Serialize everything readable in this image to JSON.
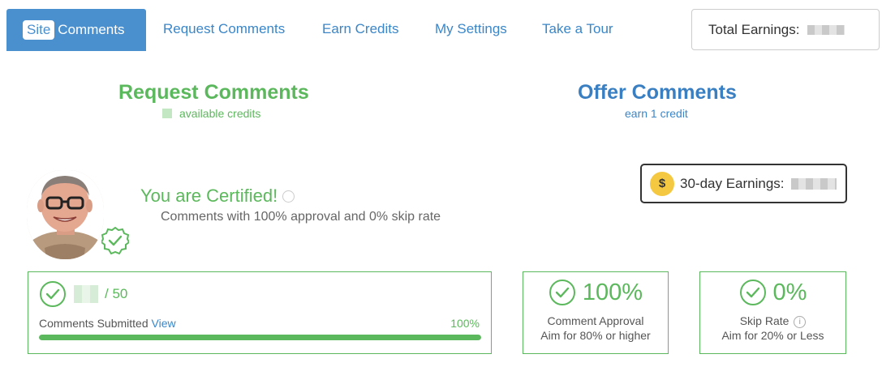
{
  "nav": {
    "active_tab": {
      "pill": "Site",
      "label": "Comments"
    },
    "links": [
      "Request Comments",
      "Earn Credits",
      "My Settings",
      "Take a Tour"
    ],
    "total_earnings_label": "Total Earnings:"
  },
  "request": {
    "title": "Request Comments",
    "subtitle": "available credits"
  },
  "offer": {
    "title": "Offer Comments",
    "subtitle": "earn 1 credit"
  },
  "certified": {
    "title": "You are Certified!",
    "description": "Comments with 100% approval and 0% skip rate"
  },
  "earnings_30day": {
    "icon": "$",
    "label": "30-day Earnings:"
  },
  "stats": {
    "submitted": {
      "total": "/ 50",
      "label": "Comments Submitted",
      "link": "View",
      "percent": "100%",
      "progress": 1.0
    },
    "approval": {
      "value": "100%",
      "label": "Comment Approval",
      "hint": "Aim for 80% or higher"
    },
    "skip": {
      "value": "0%",
      "label": "Skip Rate",
      "info": "i",
      "hint": "Aim for 20% or Less"
    }
  },
  "colors": {
    "primary_blue": "#4a8fce",
    "link_blue": "#3a86c8",
    "green": "#5cb85c",
    "coin": "#f5c842"
  },
  "icons": {
    "check": "check-circle-icon",
    "certified": "certified-badge-icon",
    "coin": "dollar-coin-icon",
    "info": "info-icon"
  }
}
